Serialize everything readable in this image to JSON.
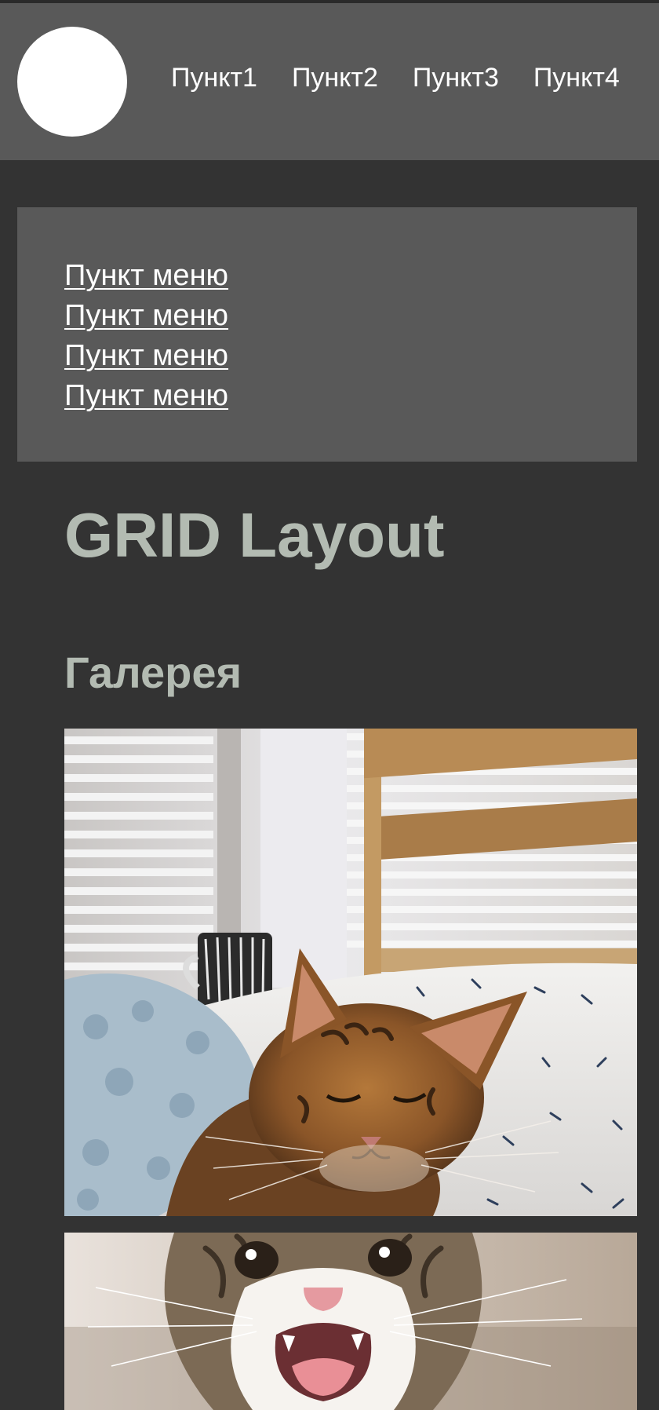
{
  "header": {
    "nav": [
      "Пункт1",
      "Пункт2",
      "Пункт3",
      "Пункт4"
    ]
  },
  "menu": {
    "items": [
      "Пункт меню",
      "Пункт меню",
      "Пункт меню",
      "Пункт меню"
    ]
  },
  "main": {
    "title": "GRID Layout",
    "gallery_title": "Галерея"
  },
  "gallery": {
    "images": [
      {
        "subject": "sleeping-tabby-cat-photo"
      },
      {
        "subject": "meowing-cat-photo"
      }
    ]
  },
  "colors": {
    "page_background": "#333333",
    "panel_background": "#595959",
    "heading": "#b3bbb2",
    "link": "#ffffff"
  }
}
